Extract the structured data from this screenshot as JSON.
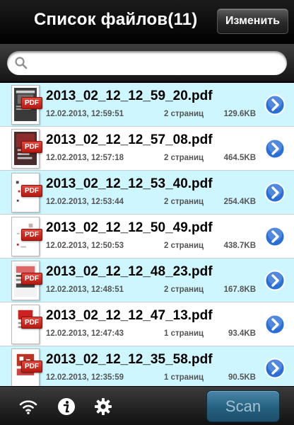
{
  "header": {
    "title": "Список файлов(11)",
    "edit_label": "Изменить"
  },
  "search": {
    "placeholder": "",
    "icon": "search-icon"
  },
  "files": [
    {
      "name": "2013_02_12_12_59_20.pdf",
      "date": "12.02.2013, 12:59:51",
      "pages": "2 страниц",
      "size": "129.6KB",
      "badge": "PDF"
    },
    {
      "name": "2013_02_12_12_57_08.pdf",
      "date": "12.02.2013, 12:57:18",
      "pages": "2 страниц",
      "size": "464.5KB",
      "badge": "PDF"
    },
    {
      "name": "2013_02_12_12_53_40.pdf",
      "date": "12.02.2013, 12:53:44",
      "pages": "2 страниц",
      "size": "254.4KB",
      "badge": "PDF"
    },
    {
      "name": "2013_02_12_12_50_49.pdf",
      "date": "12.02.2013, 12:50:53",
      "pages": "2 страниц",
      "size": "438.7KB",
      "badge": "PDF"
    },
    {
      "name": "2013_02_12_12_48_23.pdf",
      "date": "12.02.2013, 12:48:51",
      "pages": "2 страниц",
      "size": "167.8KB",
      "badge": "PDF"
    },
    {
      "name": "2013_02_12_12_47_13.pdf",
      "date": "12.02.2013, 12:47:43",
      "pages": "1 страниц",
      "size": "93.4KB",
      "badge": "PDF"
    },
    {
      "name": "2013_02_12_12_35_58.pdf",
      "date": "12.02.2013, 12:35:59",
      "pages": "1 страниц",
      "size": "90.5KB",
      "badge": "PDF"
    }
  ],
  "toolbar": {
    "icons": [
      "wifi-icon",
      "info-icon",
      "gear-icon"
    ],
    "scan_label": "Scan"
  },
  "colors": {
    "row_highlight": "#cdf6ff",
    "disclosure_blue": "#2a6fd6",
    "pdf_red": "#c62a1f",
    "scan_button": "#25607f"
  }
}
